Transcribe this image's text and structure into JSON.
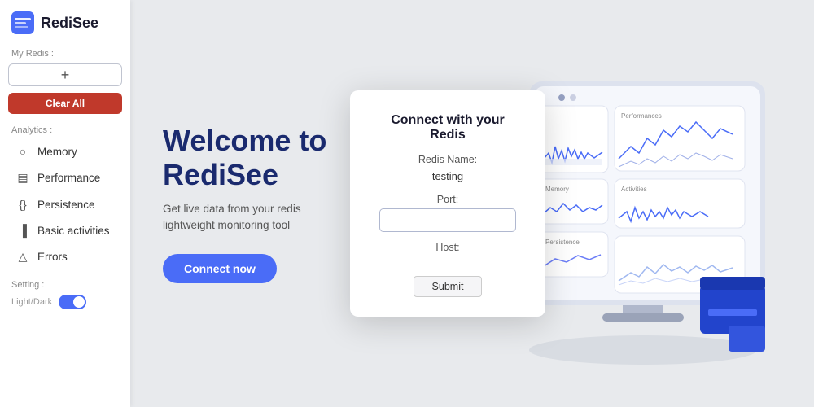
{
  "app": {
    "name": "RediSee"
  },
  "sidebar": {
    "my_redis_label": "My Redis :",
    "add_label": "+",
    "clear_all_label": "Clear All",
    "analytics_label": "Analytics :",
    "nav_items": [
      {
        "id": "memory",
        "label": "Memory",
        "icon": "○"
      },
      {
        "id": "performance",
        "label": "Performance",
        "icon": "▤"
      },
      {
        "id": "persistence",
        "label": "Persistence",
        "icon": "{}"
      },
      {
        "id": "basic-activities",
        "label": "Basic activities",
        "icon": "▐"
      },
      {
        "id": "errors",
        "label": "Errors",
        "icon": "△"
      }
    ],
    "setting_label": "Setting :",
    "toggle_label": "Light/Dark"
  },
  "main": {
    "welcome_title_line1": "Welcome to",
    "welcome_title_line2": "RediSee",
    "welcome_subtitle": "Get live data from your redis lightweight monitoring tool",
    "connect_now_label": "Connect now"
  },
  "modal": {
    "title": "Connect with your Redis",
    "redis_name_label": "Redis Name:",
    "redis_name_value": "testing",
    "port_label": "Port:",
    "port_value": "",
    "port_placeholder": "",
    "host_label": "Host:",
    "host_value": "",
    "submit_label": "Submit"
  },
  "illustration": {
    "panels": [
      {
        "label": "Performances"
      },
      {
        "label": "Activities"
      },
      {
        "label": "Memory"
      },
      {
        "label": "Persistence"
      }
    ]
  }
}
